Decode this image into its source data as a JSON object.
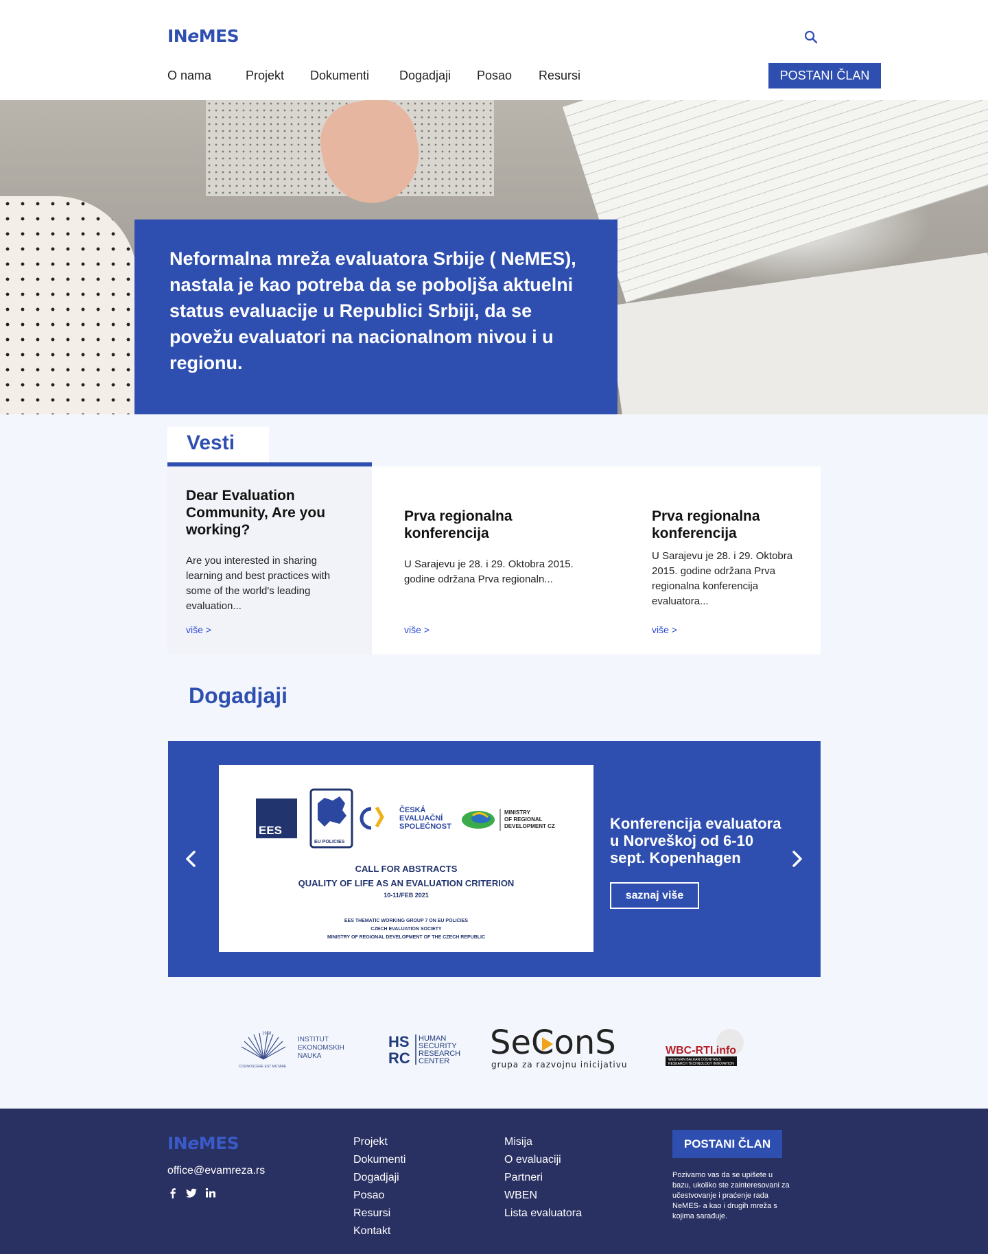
{
  "header": {
    "logo": "INeMES",
    "nav": [
      "O nama",
      "Projekt",
      "Dokumenti",
      "Dogadjaji",
      "Posao",
      "Resursi"
    ],
    "cta": "POSTANI ČLAN"
  },
  "hero": {
    "text": "Neformalna mreža evaluatora Srbije ( NeMES), nastala je kao potreba da se poboljša aktuelni status evaluacije u Republici Srbiji, da se povežu evaluatori na nacionalnom nivou i u regionu."
  },
  "news": {
    "title": "Vesti",
    "items": [
      {
        "title": "Dear Evaluation Community,  Are you working?",
        "text": "Are you interested in sharing learning and best practices with some of the world's leading evaluation...",
        "more": "više >"
      },
      {
        "title": "Prva regionalna konferencija",
        "text": "U Sarajevu je 28. i 29. Oktobra 2015. godine održana Prva regionaln...",
        "more": "više >"
      },
      {
        "title": "Prva regionalna konferencija",
        "text": "U Sarajevu je 28. i 29. Oktobra 2015. godine održana Prva regionalna konferencija evaluatora...",
        "more": "više >"
      }
    ]
  },
  "events": {
    "title": "Dogadjaji",
    "image": {
      "ees": "EES",
      "eu": "EU POLICIES",
      "ceska": [
        "ČESKÁ",
        "EVALUAČNÍ",
        "SPOLEČNOST"
      ],
      "ministry": [
        "MINISTRY",
        "OF REGIONAL",
        "DEVELOPMENT CZ"
      ],
      "call1": "CALL FOR ABSTRACTS",
      "call2": "QUALITY OF LIFE AS AN EVALUATION CRITERION",
      "date": "10-11/FEB 2021",
      "org1": "EES THEMATIC WORKING GROUP 7 ON EU POLICIES",
      "org2": "CZECH EVALUATION SOCIETY",
      "org3": "MINISTRY OF REGIONAL DEVELOPMENT OF THE CZECH REPUBLIC"
    },
    "event_title": "Konferencija evaluatora u Norveškoj od 6-10 sept. Kopenhagen",
    "button": "saznaj više"
  },
  "partners": {
    "ien": {
      "year": "1958",
      "lines": [
        "INSTITUT",
        "EKONOMSKIH",
        "NAUKA"
      ],
      "motto": "COGNOSCERE EST MUTARE"
    },
    "hsrc": {
      "mark1": "HS",
      "mark2": "RC",
      "lines": [
        "HUMAN",
        "SECURITY",
        "RESEARCH",
        "CENTER"
      ]
    },
    "secons": {
      "name": "SeConS",
      "sub": "grupa za razvojnu inicijativu"
    },
    "wbc": {
      "name": "WBC-RTI.info",
      "sub1": "WESTERN BALKAN COUNTRIES",
      "sub2": "RESEARCH TECHNOLOGY INNOVATION"
    }
  },
  "footer": {
    "logo": "INeMES",
    "email": "office@evamreza.rs",
    "col1": [
      "Projekt",
      "Dokumenti",
      "Dogadjaji",
      "Posao",
      "Resursi",
      "Kontakt"
    ],
    "col2": [
      "Misija",
      "O evaluaciji",
      "Partneri",
      "WBEN",
      "Lista evaluatora"
    ],
    "cta": "POSTANI ČLAN",
    "note": "Pozivamo vas da se upišete u bazu, ukoliko ste zainteresovani za učestvovanje i praćenje rada NeMES- a kao i drugih mreža s kojima sarađuje."
  },
  "colors": {
    "brand": "#2f4fb0",
    "footer_bg": "#293062",
    "link": "#2b4ad8"
  },
  "icons": [
    "search-icon",
    "chevron-left-icon",
    "chevron-right-icon",
    "facebook-icon",
    "twitter-icon",
    "linkedin-icon"
  ]
}
